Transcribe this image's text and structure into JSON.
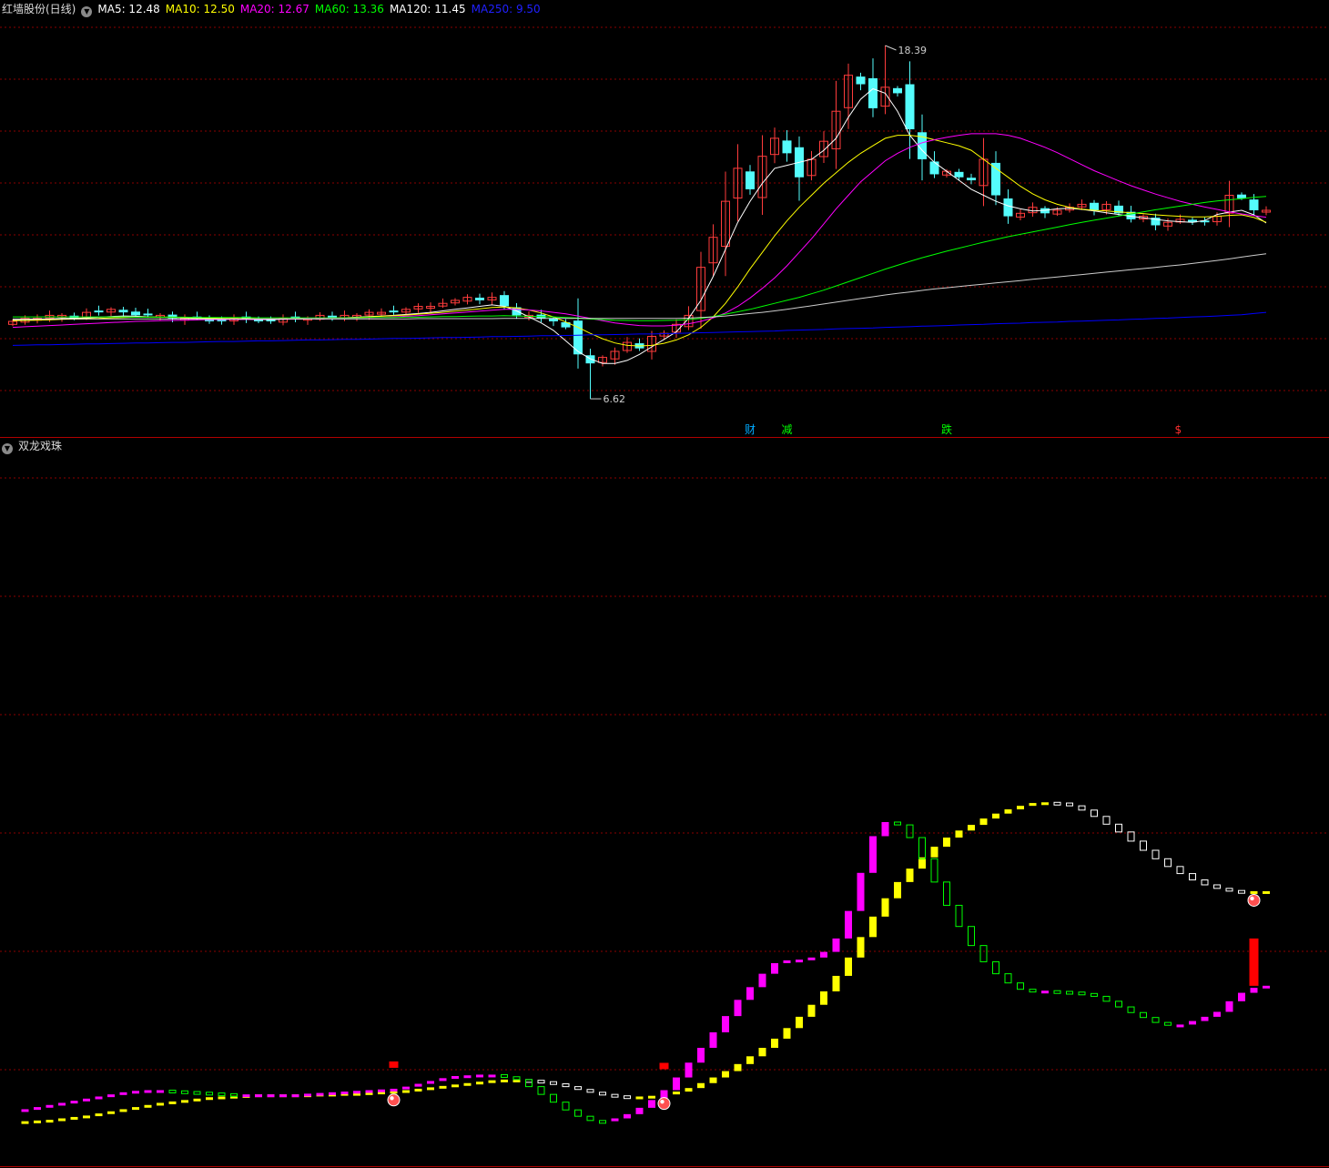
{
  "top_header": {
    "title": "红墙股份(日线)",
    "ma": [
      {
        "label": "MA5: 12.48",
        "color": "#ffffff"
      },
      {
        "label": "MA10: 12.50",
        "color": "#ffff00"
      },
      {
        "label": "MA20: 12.67",
        "color": "#ff00ff"
      },
      {
        "label": "MA60: 13.36",
        "color": "#00ff00"
      },
      {
        "label": "MA120: 11.45",
        "color": "#ffffff"
      },
      {
        "label": "MA250: 9.50",
        "color": "#0000ff"
      }
    ]
  },
  "bottom_header": {
    "title": "双龙戏珠"
  },
  "signals": [
    {
      "text": "财",
      "color": "#00aaff",
      "index": 60
    },
    {
      "text": "减",
      "color": "#00ff00",
      "index": 63
    },
    {
      "text": "跌",
      "color": "#00ff00",
      "index": 76
    },
    {
      "text": "$",
      "color": "#ff3030",
      "index": 95
    }
  ],
  "colors": {
    "up": "#ff3c3c",
    "down": "#54fcfc",
    "grid": "#8b0000",
    "magenta": "#ff00ff",
    "green": "#00ff00",
    "yellow": "#ffff00",
    "white": "#ffffff"
  },
  "chart_data": [
    {
      "type": "candlestick",
      "y_range": [
        5.5,
        19.3
      ],
      "high_label": "18.39",
      "low_label": "6.62",
      "high_index": 71,
      "low_index": 47,
      "closes": [
        9.2,
        9.3,
        9.3,
        9.4,
        9.4,
        9.3,
        9.5,
        9.5,
        9.6,
        9.5,
        9.4,
        9.4,
        9.4,
        9.3,
        9.3,
        9.3,
        9.2,
        9.2,
        9.3,
        9.3,
        9.2,
        9.2,
        9.3,
        9.3,
        9.3,
        9.4,
        9.3,
        9.4,
        9.4,
        9.5,
        9.5,
        9.5,
        9.6,
        9.7,
        9.7,
        9.8,
        9.9,
        10.0,
        9.9,
        10.0,
        9.7,
        9.4,
        9.4,
        9.3,
        9.2,
        9.0,
        8.1,
        7.8,
        8.0,
        8.2,
        8.5,
        8.3,
        8.7,
        8.8,
        9.1,
        9.4,
        11.0,
        12.0,
        13.2,
        14.3,
        13.6,
        14.7,
        15.3,
        14.8,
        14.0,
        14.6,
        15.2,
        16.2,
        17.4,
        17.1,
        16.3,
        17.0,
        16.8,
        15.6,
        14.6,
        14.1,
        14.2,
        14.0,
        13.9,
        14.6,
        13.4,
        12.7,
        12.8,
        13.0,
        12.8,
        12.9,
        13.0,
        13.1,
        12.9,
        13.1,
        12.8,
        12.6,
        12.7,
        12.4,
        12.5,
        12.6,
        12.5,
        12.5,
        12.7,
        13.4,
        13.3,
        12.9,
        12.9
      ],
      "ma": {
        "MA5": [
          9.25,
          9.25,
          9.27,
          9.28,
          9.3,
          9.3,
          9.32,
          9.34,
          9.36,
          9.38,
          9.37,
          9.35,
          9.34,
          9.33,
          9.32,
          9.3,
          9.29,
          9.28,
          9.27,
          9.27,
          9.26,
          9.26,
          9.27,
          9.28,
          9.29,
          9.3,
          9.31,
          9.32,
          9.34,
          9.36,
          9.38,
          9.4,
          9.43,
          9.46,
          9.5,
          9.55,
          9.6,
          9.65,
          9.7,
          9.75,
          9.7,
          9.55,
          9.35,
          9.15,
          8.9,
          8.55,
          8.2,
          7.95,
          7.8,
          7.8,
          7.9,
          8.1,
          8.35,
          8.6,
          8.85,
          9.3,
          9.9,
          10.7,
          11.6,
          12.5,
          13.2,
          13.8,
          14.3,
          14.4,
          14.5,
          14.6,
          14.9,
          15.3,
          16.0,
          16.6,
          16.95,
          16.8,
          16.2,
          15.4,
          14.9,
          14.5,
          14.2,
          13.9,
          13.6,
          13.4,
          13.2,
          13.05,
          12.95,
          12.88,
          12.9,
          12.95,
          12.97,
          12.93,
          12.88,
          12.82,
          12.76,
          12.7,
          12.65,
          12.6,
          12.55,
          12.52,
          12.5,
          12.56,
          12.76,
          12.84,
          12.9,
          12.75,
          12.48
        ],
        "MA10": [
          9.22,
          9.23,
          9.24,
          9.25,
          9.27,
          9.28,
          9.29,
          9.3,
          9.32,
          9.33,
          9.34,
          9.34,
          9.34,
          9.34,
          9.33,
          9.32,
          9.31,
          9.3,
          9.29,
          9.29,
          9.28,
          9.28,
          9.28,
          9.28,
          9.29,
          9.3,
          9.31,
          9.32,
          9.33,
          9.35,
          9.37,
          9.39,
          9.41,
          9.44,
          9.47,
          9.5,
          9.54,
          9.58,
          9.62,
          9.66,
          9.68,
          9.65,
          9.58,
          9.48,
          9.35,
          9.18,
          9.0,
          8.8,
          8.62,
          8.48,
          8.4,
          8.38,
          8.4,
          8.47,
          8.58,
          8.75,
          9.0,
          9.35,
          9.8,
          10.35,
          10.95,
          11.5,
          12.05,
          12.55,
          13.0,
          13.4,
          13.8,
          14.15,
          14.5,
          14.8,
          15.05,
          15.3,
          15.4,
          15.4,
          15.35,
          15.25,
          15.15,
          15.05,
          14.9,
          14.6,
          14.3,
          14.0,
          13.7,
          13.45,
          13.25,
          13.1,
          13.0,
          12.94,
          12.9,
          12.88,
          12.85,
          12.82,
          12.79,
          12.75,
          12.72,
          12.7,
          12.68,
          12.68,
          12.7,
          12.73,
          12.75,
          12.66,
          12.5
        ],
        "MA20": [
          9.0,
          9.02,
          9.04,
          9.06,
          9.08,
          9.1,
          9.12,
          9.14,
          9.16,
          9.18,
          9.2,
          9.21,
          9.22,
          9.23,
          9.24,
          9.25,
          9.26,
          9.26,
          9.27,
          9.27,
          9.27,
          9.28,
          9.28,
          9.28,
          9.29,
          9.29,
          9.3,
          9.3,
          9.31,
          9.32,
          9.33,
          9.35,
          9.37,
          9.39,
          9.42,
          9.45,
          9.48,
          9.51,
          9.54,
          9.57,
          9.6,
          9.6,
          9.58,
          9.55,
          9.5,
          9.45,
          9.38,
          9.3,
          9.22,
          9.15,
          9.1,
          9.06,
          9.05,
          9.05,
          9.07,
          9.12,
          9.2,
          9.32,
          9.48,
          9.7,
          9.98,
          10.3,
          10.65,
          11.05,
          11.5,
          11.95,
          12.45,
          12.95,
          13.4,
          13.85,
          14.2,
          14.55,
          14.8,
          15.0,
          15.15,
          15.25,
          15.33,
          15.4,
          15.45,
          15.45,
          15.45,
          15.4,
          15.3,
          15.15,
          15.0,
          14.82,
          14.62,
          14.42,
          14.22,
          14.05,
          13.88,
          13.72,
          13.58,
          13.44,
          13.32,
          13.2,
          13.1,
          13.01,
          12.93,
          12.85,
          12.78,
          12.72,
          12.67
        ],
        "MA60": [
          9.35,
          9.35,
          9.35,
          9.35,
          9.35,
          9.35,
          9.35,
          9.35,
          9.35,
          9.35,
          9.34,
          9.34,
          9.34,
          9.34,
          9.34,
          9.33,
          9.33,
          9.33,
          9.33,
          9.33,
          9.32,
          9.32,
          9.32,
          9.32,
          9.32,
          9.32,
          9.32,
          9.32,
          9.32,
          9.33,
          9.33,
          9.33,
          9.34,
          9.34,
          9.35,
          9.36,
          9.36,
          9.37,
          9.38,
          9.38,
          9.39,
          9.38,
          9.37,
          9.36,
          9.35,
          9.33,
          9.31,
          9.28,
          9.26,
          9.24,
          9.23,
          9.22,
          9.22,
          9.23,
          9.24,
          9.26,
          9.3,
          9.36,
          9.44,
          9.52,
          9.6,
          9.7,
          9.8,
          9.9,
          10.0,
          10.12,
          10.24,
          10.38,
          10.52,
          10.66,
          10.8,
          10.94,
          11.07,
          11.2,
          11.32,
          11.43,
          11.54,
          11.64,
          11.74,
          11.84,
          11.93,
          12.02,
          12.1,
          12.18,
          12.26,
          12.34,
          12.42,
          12.5,
          12.57,
          12.64,
          12.71,
          12.78,
          12.85,
          12.92,
          12.98,
          13.04,
          13.1,
          13.16,
          13.21,
          13.25,
          13.29,
          13.33,
          13.36
        ],
        "MA120": [
          9.28,
          9.28,
          9.28,
          9.28,
          9.28,
          9.28,
          9.28,
          9.28,
          9.28,
          9.28,
          9.28,
          9.28,
          9.28,
          9.28,
          9.28,
          9.28,
          9.28,
          9.28,
          9.28,
          9.28,
          9.28,
          9.28,
          9.28,
          9.28,
          9.28,
          9.28,
          9.28,
          9.28,
          9.28,
          9.28,
          9.28,
          9.28,
          9.28,
          9.29,
          9.29,
          9.29,
          9.29,
          9.29,
          9.29,
          9.29,
          9.3,
          9.3,
          9.3,
          9.3,
          9.3,
          9.3,
          9.3,
          9.3,
          9.3,
          9.3,
          9.3,
          9.3,
          9.3,
          9.3,
          9.3,
          9.31,
          9.33,
          9.35,
          9.38,
          9.42,
          9.46,
          9.5,
          9.55,
          9.6,
          9.66,
          9.72,
          9.78,
          9.84,
          9.9,
          9.96,
          10.02,
          10.08,
          10.13,
          10.18,
          10.23,
          10.28,
          10.32,
          10.36,
          10.4,
          10.44,
          10.48,
          10.52,
          10.56,
          10.6,
          10.64,
          10.68,
          10.72,
          10.76,
          10.8,
          10.84,
          10.88,
          10.92,
          10.96,
          11.0,
          11.04,
          11.08,
          11.13,
          11.18,
          11.23,
          11.28,
          11.34,
          11.4,
          11.45
        ],
        "MA250": [
          8.4,
          8.41,
          8.42,
          8.42,
          8.43,
          8.44,
          8.45,
          8.45,
          8.46,
          8.47,
          8.48,
          8.48,
          8.49,
          8.5,
          8.5,
          8.51,
          8.52,
          8.53,
          8.53,
          8.54,
          8.55,
          8.55,
          8.56,
          8.57,
          8.58,
          8.58,
          8.59,
          8.6,
          8.6,
          8.61,
          8.62,
          8.63,
          8.63,
          8.64,
          8.65,
          8.66,
          8.66,
          8.67,
          8.68,
          8.69,
          8.69,
          8.7,
          8.71,
          8.72,
          8.72,
          8.73,
          8.74,
          8.75,
          8.75,
          8.76,
          8.77,
          8.78,
          8.78,
          8.79,
          8.8,
          8.81,
          8.82,
          8.83,
          8.84,
          8.85,
          8.86,
          8.87,
          8.88,
          8.9,
          8.91,
          8.92,
          8.93,
          8.95,
          8.96,
          8.97,
          8.98,
          9.0,
          9.01,
          9.02,
          9.04,
          9.05,
          9.06,
          9.08,
          9.09,
          9.1,
          9.12,
          9.13,
          9.14,
          9.16,
          9.17,
          9.18,
          9.2,
          9.21,
          9.22,
          9.24,
          9.25,
          9.27,
          9.28,
          9.3,
          9.31,
          9.33,
          9.35,
          9.36,
          9.38,
          9.4,
          9.42,
          9.46,
          9.5
        ]
      }
    },
    {
      "type": "indicator",
      "title": "双龙戏珠",
      "y_range": [
        0,
        100
      ],
      "main_line": [
        7.0,
        7.3,
        7.6,
        7.9,
        8.2,
        8.5,
        8.8,
        9.1,
        9.4,
        9.7,
        9.9,
        10.0,
        10.0,
        9.9,
        9.8,
        9.7,
        9.6,
        9.5,
        9.4,
        9.4,
        9.4,
        9.4,
        9.4,
        9.4,
        9.5,
        9.6,
        9.7,
        9.8,
        9.9,
        10.0,
        10.1,
        10.2,
        10.5,
        10.9,
        11.3,
        11.7,
        12.0,
        12.1,
        12.2,
        12.2,
        11.9,
        11.5,
        10.5,
        9.4,
        8.3,
        7.2,
        6.3,
        5.7,
        5.6,
        6.0,
        6.6,
        7.5,
        8.6,
        10.0,
        11.8,
        13.9,
        16.0,
        18.2,
        20.5,
        22.8,
        24.6,
        26.5,
        28.0,
        28.4,
        28.5,
        28.8,
        29.6,
        31.5,
        35.4,
        40.8,
        46.0,
        48.0,
        47.6,
        45.8,
        42.8,
        39.5,
        36.2,
        33.2,
        30.5,
        28.2,
        26.5,
        25.2,
        24.3,
        24.1,
        24.1,
        24.0,
        23.9,
        23.7,
        23.3,
        22.6,
        21.8,
        21.0,
        20.3,
        19.6,
        19.2,
        19.3,
        19.8,
        20.4,
        21.1,
        22.6,
        23.8,
        24.5,
        24.8
      ],
      "signal_line": [
        5.5,
        5.6,
        5.7,
        5.8,
        6.0,
        6.2,
        6.4,
        6.7,
        7.0,
        7.3,
        7.6,
        7.9,
        8.2,
        8.4,
        8.6,
        8.8,
        9.0,
        9.1,
        9.2,
        9.3,
        9.4,
        9.4,
        9.4,
        9.4,
        9.4,
        9.5,
        9.5,
        9.6,
        9.6,
        9.7,
        9.8,
        9.9,
        10.0,
        10.2,
        10.4,
        10.6,
        10.8,
        11.0,
        11.2,
        11.4,
        11.5,
        11.5,
        11.4,
        11.2,
        10.9,
        10.5,
        10.1,
        9.7,
        9.4,
        9.2,
        9.1,
        9.1,
        9.2,
        9.4,
        9.8,
        10.3,
        11.0,
        11.8,
        12.7,
        13.7,
        14.8,
        16.0,
        17.3,
        18.8,
        20.4,
        22.1,
        24.0,
        26.2,
        28.8,
        31.7,
        34.6,
        37.2,
        39.5,
        41.4,
        43.0,
        44.5,
        45.8,
        46.8,
        47.6,
        48.5,
        49.2,
        49.8,
        50.3,
        50.7,
        50.8,
        50.7,
        50.3,
        49.7,
        48.8,
        47.7,
        46.6,
        45.3,
        44.0,
        42.8,
        41.7,
        40.7,
        39.8,
        39.1,
        38.6,
        38.3,
        38.2,
        38.2,
        38.2
      ],
      "main_line_colors": "rising magenta filled / falling green hollow",
      "signal_line_colors": "rising yellow filled / falling white hollow",
      "red_marks": [
        31,
        53,
        101
      ],
      "ball_marks": [
        31,
        53,
        101
      ]
    }
  ]
}
